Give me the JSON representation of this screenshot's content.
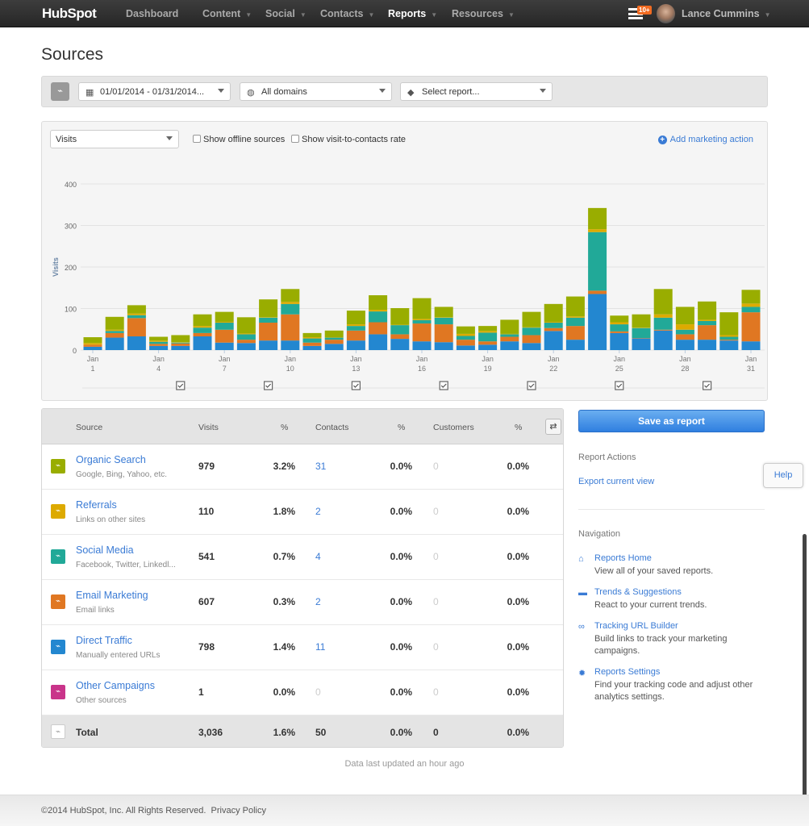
{
  "nav": {
    "logo": "HubSpot",
    "items": [
      {
        "label": "Dashboard",
        "caret": false
      },
      {
        "label": "Content",
        "caret": true
      },
      {
        "label": "Social",
        "caret": true
      },
      {
        "label": "Contacts",
        "caret": true
      },
      {
        "label": "Reports",
        "caret": true,
        "active": true
      },
      {
        "label": "Resources",
        "caret": true
      }
    ],
    "notification_badge": "10+",
    "user": "Lance Cummins"
  },
  "page_title": "Sources",
  "filters": {
    "date_range": "01/01/2014 - 01/31/2014...",
    "domain": "All domains",
    "report": "Select report..."
  },
  "chart_controls": {
    "metric": "Visits",
    "show_offline": "Show offline sources",
    "show_rate": "Show visit-to-contacts rate",
    "add_action": "Add marketing action"
  },
  "chart_data": {
    "type": "bar",
    "stacked": true,
    "ylabel": "Visits",
    "ylim": [
      0,
      400
    ],
    "yticks": [
      0,
      100,
      200,
      300,
      400
    ],
    "grid": true,
    "categories": [
      "1",
      "2",
      "3",
      "4",
      "5",
      "6",
      "7",
      "8",
      "9",
      "10",
      "11",
      "12",
      "13",
      "14",
      "15",
      "16",
      "17",
      "18",
      "19",
      "20",
      "21",
      "22",
      "23",
      "24",
      "25",
      "26",
      "27",
      "28",
      "29",
      "30",
      "31"
    ],
    "xtick_labels": [
      {
        "day": 1,
        "month": "Jan",
        "label": "1"
      },
      {
        "day": 4,
        "month": "Jan",
        "label": "4"
      },
      {
        "day": 7,
        "month": "Jan",
        "label": "7"
      },
      {
        "day": 10,
        "month": "Jan",
        "label": "10"
      },
      {
        "day": 13,
        "month": "Jan",
        "label": "13"
      },
      {
        "day": 16,
        "month": "Jan",
        "label": "16"
      },
      {
        "day": 19,
        "month": "Jan",
        "label": "19"
      },
      {
        "day": 22,
        "month": "Jan",
        "label": "22"
      },
      {
        "day": 25,
        "month": "Jan",
        "label": "25"
      },
      {
        "day": 28,
        "month": "Jan",
        "label": "28"
      },
      {
        "day": 31,
        "month": "Jan",
        "label": "31"
      }
    ],
    "marketing_action_days": [
      5,
      9,
      13,
      17,
      21,
      25,
      29
    ],
    "series": [
      {
        "name": "Direct Traffic",
        "color": "#2387d0",
        "values": [
          8,
          30,
          33,
          10,
          10,
          33,
          18,
          17,
          23,
          23,
          10,
          15,
          23,
          38,
          27,
          21,
          19,
          11,
          13,
          21,
          17,
          46,
          25,
          135,
          41,
          28,
          47,
          25,
          25,
          23,
          21
        ]
      },
      {
        "name": "Email Marketing",
        "color": "#e07722",
        "values": [
          5,
          11,
          44,
          5,
          6,
          8,
          31,
          8,
          43,
          63,
          8,
          10,
          24,
          29,
          11,
          43,
          43,
          14,
          8,
          11,
          19,
          7,
          33,
          8,
          4,
          1,
          2,
          13,
          35,
          2,
          70
        ]
      },
      {
        "name": "Social Media",
        "color": "#21a998",
        "values": [
          0,
          5,
          7,
          5,
          2,
          13,
          17,
          13,
          12,
          25,
          10,
          5,
          11,
          26,
          22,
          8,
          16,
          9,
          21,
          6,
          18,
          13,
          20,
          141,
          17,
          24,
          29,
          11,
          10,
          7,
          13
        ]
      },
      {
        "name": "Referrals",
        "color": "#ddaa00",
        "values": [
          4,
          3,
          4,
          3,
          1,
          4,
          2,
          2,
          1,
          5,
          3,
          1,
          4,
          4,
          1,
          3,
          1,
          5,
          4,
          1,
          1,
          2,
          3,
          7,
          5,
          1,
          8,
          13,
          3,
          4,
          8
        ]
      },
      {
        "name": "Organic Search",
        "color": "#99ad00",
        "values": [
          14,
          31,
          20,
          9,
          17,
          28,
          24,
          39,
          43,
          31,
          10,
          16,
          33,
          35,
          40,
          50,
          25,
          18,
          12,
          34,
          37,
          43,
          48,
          51,
          16,
          32,
          61,
          42,
          44,
          55,
          33
        ]
      }
    ]
  },
  "table": {
    "headers": {
      "source": "Source",
      "visits": "Visits",
      "pct1": "%",
      "contacts": "Contacts",
      "pct2": "%",
      "customers": "Customers",
      "pct3": "%"
    },
    "rows": [
      {
        "name": "Organic Search",
        "sub": "Google, Bing, Yahoo, etc.",
        "color": "#99ad00",
        "visits": "979",
        "visit_pct": "3.2%",
        "contacts": "31",
        "contact_pct": "0.0%",
        "customers": "0",
        "customer_pct": "0.0%"
      },
      {
        "name": "Referrals",
        "sub": "Links on other sites",
        "color": "#ddaa00",
        "visits": "110",
        "visit_pct": "1.8%",
        "contacts": "2",
        "contact_pct": "0.0%",
        "customers": "0",
        "customer_pct": "0.0%"
      },
      {
        "name": "Social Media",
        "sub": "Facebook, Twitter, Linkedl...",
        "color": "#21a998",
        "visits": "541",
        "visit_pct": "0.7%",
        "contacts": "4",
        "contact_pct": "0.0%",
        "customers": "0",
        "customer_pct": "0.0%"
      },
      {
        "name": "Email Marketing",
        "sub": "Email links",
        "color": "#e07722",
        "visits": "607",
        "visit_pct": "0.3%",
        "contacts": "2",
        "contact_pct": "0.0%",
        "customers": "0",
        "customer_pct": "0.0%"
      },
      {
        "name": "Direct Traffic",
        "sub": "Manually entered URLs",
        "color": "#2387d0",
        "visits": "798",
        "visit_pct": "1.4%",
        "contacts": "11",
        "contact_pct": "0.0%",
        "customers": "0",
        "customer_pct": "0.0%"
      },
      {
        "name": "Other Campaigns",
        "sub": "Other sources",
        "color": "#c9348a",
        "visits": "1",
        "visit_pct": "0.0%",
        "contacts": "0",
        "contact_pct": "0.0%",
        "customers": "0",
        "customer_pct": "0.0%"
      }
    ],
    "total": {
      "name": "Total",
      "visits": "3,036",
      "visit_pct": "1.6%",
      "contacts": "50",
      "contact_pct": "0.0%",
      "customers": "0",
      "customer_pct": "0.0%"
    }
  },
  "updated": "Data last updated an hour ago",
  "sidebar": {
    "save": "Save as report",
    "actions_heading": "Report Actions",
    "export": "Export current view",
    "nav_heading": "Navigation",
    "nav": [
      {
        "label": "Reports Home",
        "desc": "View all of your saved reports.",
        "icon": "home-icon"
      },
      {
        "label": "Trends & Suggestions",
        "desc": "React to your current trends.",
        "icon": "inbox-icon"
      },
      {
        "label": "Tracking URL Builder",
        "desc": "Build links to track your marketing campaigns.",
        "icon": "link-icon"
      },
      {
        "label": "Reports Settings",
        "desc": "Find your tracking code and adjust other analytics settings.",
        "icon": "gear-icon"
      }
    ]
  },
  "help": "Help",
  "footer": {
    "copyright": "©2014 HubSpot, Inc. All Rights Reserved.",
    "privacy": "Privacy Policy"
  }
}
